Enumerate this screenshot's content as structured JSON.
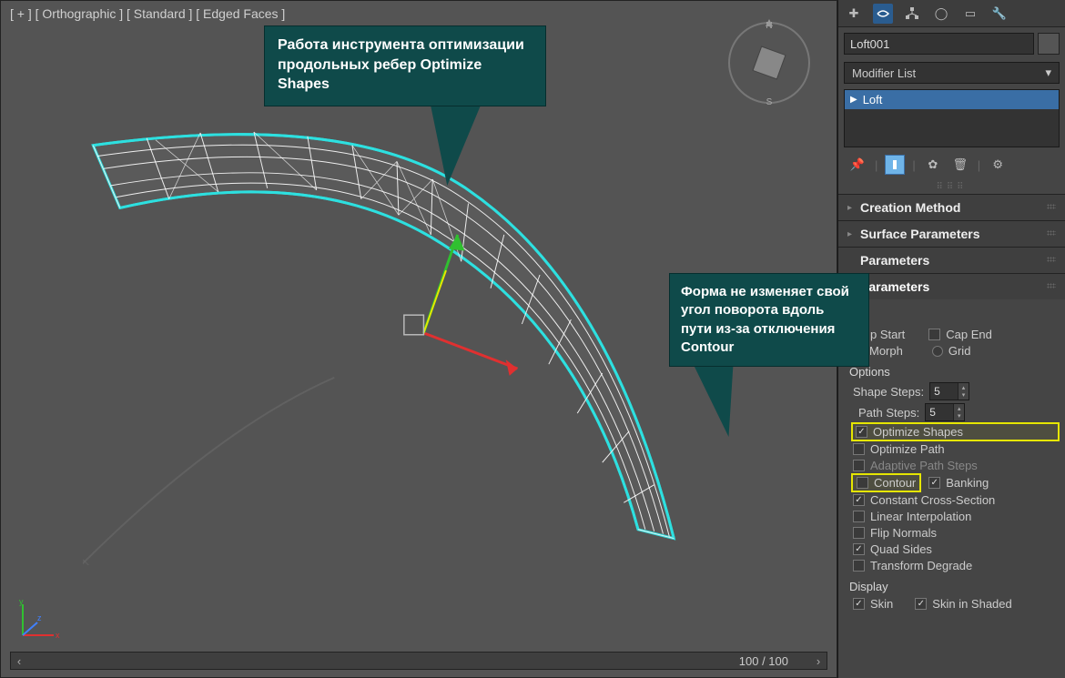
{
  "viewport": {
    "label": "[ + ] [ Orthographic ] [ Standard ] [ Edged Faces ]",
    "page_readout": "100 / 100"
  },
  "callouts": {
    "optimize_shapes": "Работа инструмента оптимизации продольных ребер Optimize Shapes",
    "contour_off": "Форма не изменяет свой угол поворота вдоль пути из-за отключения Contour"
  },
  "panel": {
    "object_name": "Loft001",
    "modifier_list_label": "Modifier List",
    "mod_item": "Loft",
    "rollouts": {
      "creation_method": "Creation Method",
      "surface_parameters": "Surface Parameters",
      "parameters_1": "Parameters",
      "parameters_2": "Parameters"
    },
    "capping": {
      "group": "g",
      "cap_start": "p Start",
      "cap_end": "Cap End",
      "morph": "Morph",
      "grid": "Grid"
    },
    "options": {
      "group": "Options",
      "shape_steps": "Shape Steps:",
      "shape_steps_val": "5",
      "path_steps": "Path Steps:",
      "path_steps_val": "5",
      "optimize_shapes": "Optimize Shapes",
      "optimize_path": "Optimize Path",
      "adaptive_path_steps": "Adaptive Path Steps",
      "contour": "Contour",
      "banking": "Banking",
      "constant_cross": "Constant Cross-Section",
      "linear_interp": "Linear Interpolation",
      "flip_normals": "Flip Normals",
      "quad_sides": "Quad Sides",
      "transform_degrade": "Transform Degrade"
    },
    "display": {
      "group": "Display",
      "skin": "Skin",
      "skin_in_shaded": "Skin in Shaded"
    }
  }
}
